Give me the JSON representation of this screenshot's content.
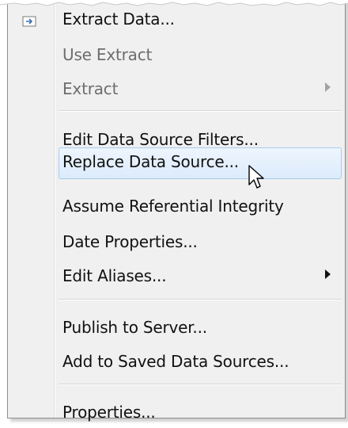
{
  "menu": {
    "items": [
      {
        "label": "Extract Data..."
      },
      {
        "label": "Use Extract",
        "disabled": true
      },
      {
        "label": "Extract",
        "disabled": true,
        "submenu": true
      },
      {
        "label": "Edit Data Source Filters..."
      },
      {
        "label": "Replace Data Source...",
        "highlighted": true
      },
      {
        "label": "Assume Referential Integrity"
      },
      {
        "label": "Date Properties..."
      },
      {
        "label": "Edit Aliases...",
        "submenu": true
      },
      {
        "label": "Publish to Server..."
      },
      {
        "label": "Add to Saved Data Sources..."
      },
      {
        "label": "Properties..."
      }
    ]
  },
  "icons": {
    "extract": "extract-data-icon",
    "cursor": "mouse-pointer-icon"
  },
  "colors": {
    "menu_bg": "#f0f0f0",
    "highlight_border": "#a8cbee",
    "highlight_fill": "#dcebfc",
    "disabled_text": "#6d6d6d"
  }
}
